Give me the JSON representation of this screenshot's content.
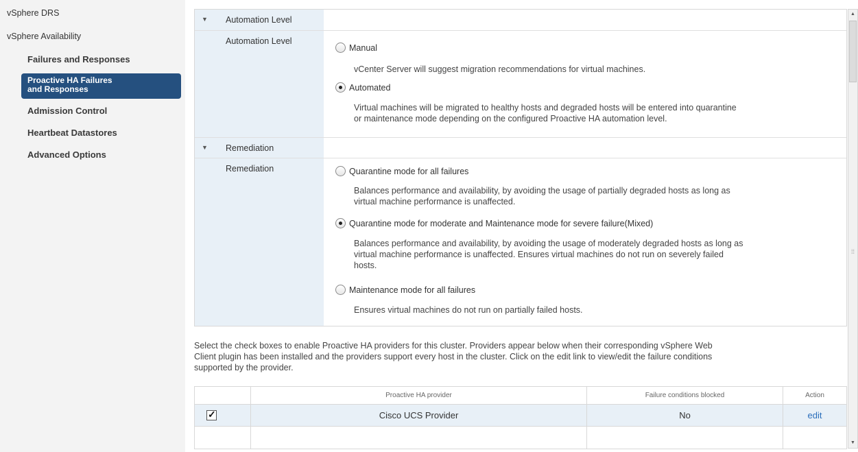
{
  "sidebar": {
    "items": [
      {
        "label": "vSphere DRS"
      },
      {
        "label": "vSphere Availability"
      },
      {
        "label": "Failures and Responses"
      },
      {
        "label_line1": "Proactive HA Failures",
        "label_line2": "and Responses"
      },
      {
        "label": "Admission Control"
      },
      {
        "label": "Heartbeat Datastores"
      },
      {
        "label": "Advanced Options"
      }
    ]
  },
  "automation": {
    "section_title": "Automation Level",
    "field_label": "Automation Level",
    "options": [
      {
        "label": "Manual",
        "selected": false,
        "description": "vCenter Server will suggest migration recommendations for virtual machines."
      },
      {
        "label": "Automated",
        "selected": true,
        "description_line1": "Virtual machines will be migrated to healthy hosts and degraded hosts will be entered into quarantine",
        "description_line2": "or maintenance mode depending on the configured Proactive HA automation level."
      }
    ]
  },
  "remediation": {
    "section_title": "Remediation",
    "field_label": "Remediation",
    "options": [
      {
        "label": "Quarantine mode for all failures",
        "selected": false,
        "description_line1": "Balances performance and availability, by avoiding the usage of partially degraded hosts as long as",
        "description_line2": "virtual machine performance is unaffected."
      },
      {
        "label": "Quarantine mode for moderate and Maintenance mode for severe failure(Mixed)",
        "selected": true,
        "description_line1": "Balances performance and availability, by avoiding the usage of moderately degraded hosts as long as",
        "description_line2": "virtual machine performance is unaffected. Ensures virtual machines do not run on severely failed",
        "description_line3": "hosts."
      },
      {
        "label": "Maintenance mode for all failures",
        "selected": false,
        "description": "Ensures virtual machines do not run on partially failed hosts."
      }
    ]
  },
  "info": {
    "line1": "Select the check boxes to enable Proactive HA providers for this cluster. Providers appear below when their corresponding vSphere Web",
    "line2": "Client plugin has been installed and the providers support every host in the cluster. Click on the edit link to view/edit the failure conditions",
    "line3": "supported by the provider."
  },
  "providers_table": {
    "headers": {
      "provider": "Proactive HA provider",
      "failure_conditions": "Failure conditions blocked",
      "action": "Action"
    },
    "rows": [
      {
        "checked": true,
        "check_glyph": "✓",
        "provider": "Cisco UCS Provider",
        "failure_conditions": "No",
        "action": "edit"
      }
    ]
  },
  "scrollbar": {
    "up_glyph": "▲",
    "down_glyph": "▼",
    "grip_glyph": "⁞⁞"
  }
}
